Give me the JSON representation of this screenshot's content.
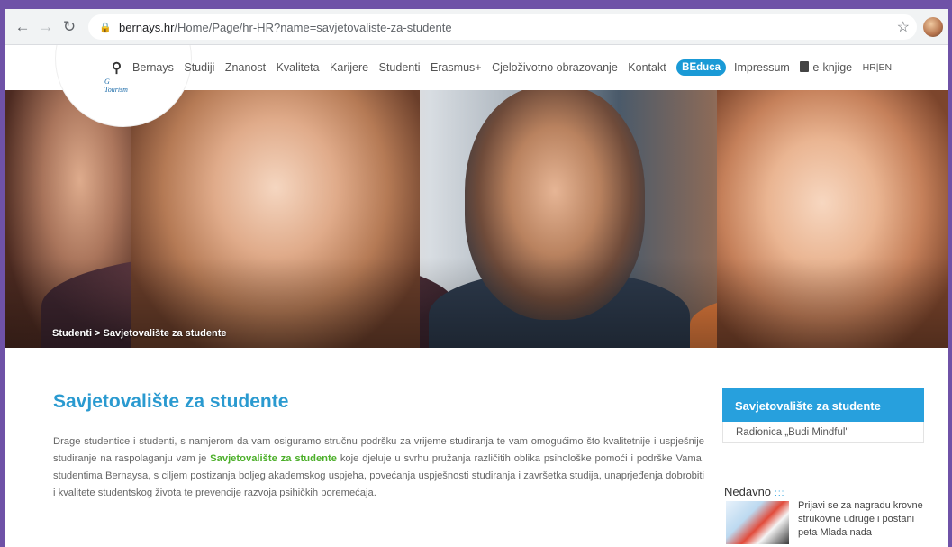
{
  "browser": {
    "url_host": "bernays.hr",
    "url_path": "/Home/Page/hr-HR?name=savjetovaliste-za-studente"
  },
  "nav": {
    "logo_text_1": "G",
    "logo_text_2": "Tourism",
    "items": [
      "Bernays",
      "Studiji",
      "Znanost",
      "Kvaliteta",
      "Karijere",
      "Studenti",
      "Erasmus+",
      "Cjeloživotno obrazovanje",
      "Kontakt"
    ],
    "beduca": "BEduca",
    "impressum": "Impressum",
    "ebooks": "e-knjige",
    "lang": "HR|EN"
  },
  "breadcrumb": "Studenti > Savjetovalište za studente",
  "main": {
    "title": "Savjetovalište za studente",
    "para_before": "Drage studentice i studenti, s namjerom da vam osiguramo stručnu podršku za vrijeme studiranja te vam omogućimo što kvalitetnije i uspješnije studiranje na raspolaganju vam je ",
    "para_highlight": "Savjetovalište za studente",
    "para_after": " koje djeluje u svrhu pružanja različitih oblika psihološke pomoći i podrške Vama, studentima Bernaysa, s ciljem postizanja boljeg akademskog uspjeha, povećanja uspješnosti studiranja i završetka studija, unaprjeđenja dobrobiti i kvalitete studentskog života te prevencije razvoja psihičkih poremećaja."
  },
  "sidebar": {
    "active": "Savjetovalište za studente",
    "link": "Radionica „Budi Mindful\""
  },
  "recent": {
    "title": "Nedavno",
    "dots": ":::",
    "item_text": "Prijavi se za nagradu krovne strukovne udruge i postani peta Mlada nada"
  }
}
